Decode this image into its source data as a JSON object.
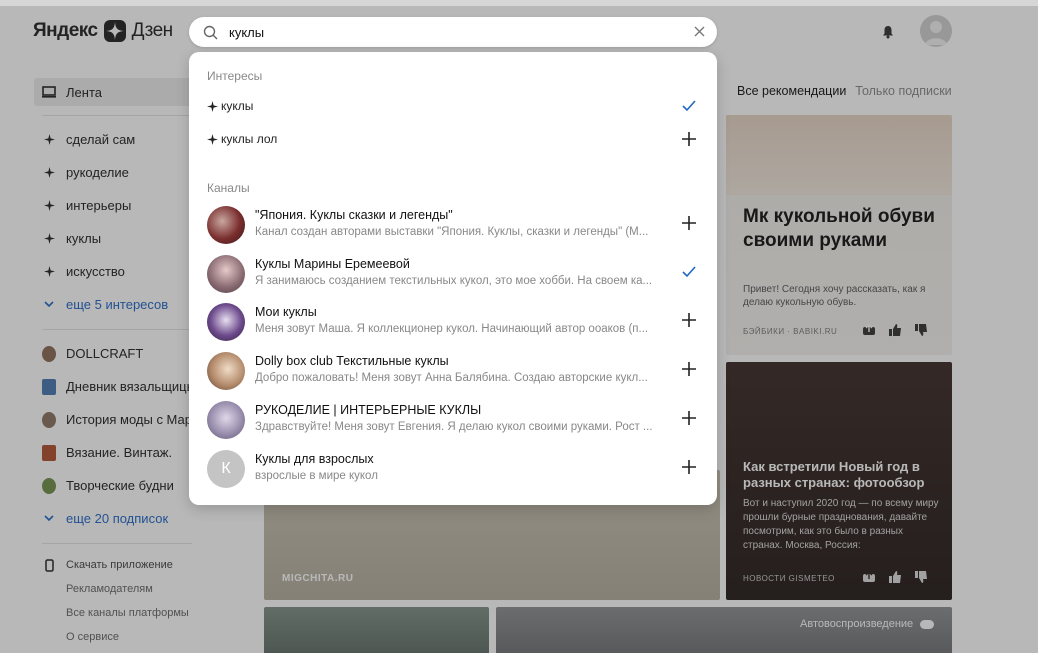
{
  "header": {
    "logo_left": "Яндекс",
    "logo_right": "Дзен"
  },
  "search": {
    "value": "куклы",
    "placeholder": ""
  },
  "dropdown": {
    "interests_title": "Интересы",
    "interests": [
      {
        "label": "куклы",
        "state": "added"
      },
      {
        "label": "куклы лол",
        "state": "add"
      }
    ],
    "channels_title": "Каналы",
    "channels": [
      {
        "name": "\"Япония. Куклы сказки и легенды\"",
        "desc": "Канал создан авторами выставки \"Япония. Куклы, сказки и легенды\" (М...",
        "state": "add",
        "avatar_color": "#7a2e2e"
      },
      {
        "name": "Куклы Марины Еремеевой",
        "desc": "Я занимаюсь созданием текстильных кукол, это мое хобби. На своем ка...",
        "state": "added",
        "avatar_color": "#8d6f76"
      },
      {
        "name": "Мои куклы",
        "desc": "Меня зовут Маша. Я коллекционер кукол. Начинающий автор ооаков (п...",
        "state": "add",
        "avatar_color": "#6d4a8c"
      },
      {
        "name": "Dolly box club Текстильные куклы",
        "desc": "Добро пожаловать! Меня зовут Анна Балябина. Создаю авторские кукл...",
        "state": "add",
        "avatar_color": "#b48b6b"
      },
      {
        "name": "РУКОДЕЛИЕ | ИНТЕРЬЕРНЫЕ КУКЛЫ",
        "desc": "Здравствуйте! Меня зовут Евгения. Я делаю кукол своими руками. Рост ...",
        "state": "add",
        "avatar_color": "#9a8fae"
      },
      {
        "name": "Куклы для взрослых",
        "desc": "взрослые в мире кукол",
        "state": "add",
        "avatar_color": "#c4c4c4",
        "avatar_letter": "К"
      }
    ]
  },
  "sidebar": {
    "feed": "Лента",
    "interests": [
      "сделай сам",
      "рукоделие",
      "интерьеры",
      "куклы",
      "искусство"
    ],
    "more_interests": "еще 5 интересов",
    "channels": [
      {
        "label": "DOLLCRAFT",
        "color": "#8a6a55"
      },
      {
        "label": "Дневник вязальщицы",
        "color": "#4a78b0"
      },
      {
        "label": "История моды с Марь",
        "color": "#8a7360"
      },
      {
        "label": "Вязание. Винтаж.",
        "color": "#b0502e"
      },
      {
        "label": "Творческие будни",
        "color": "#6f8f4a"
      }
    ],
    "more_subs": "еще 20 подписок",
    "download": "Скачать приложение",
    "links": [
      "Рекламодателям",
      "Все каналы платформы",
      "О сервисе"
    ]
  },
  "feed": {
    "tab_all": "Все рекомендации",
    "tab_subs": "Только подписки",
    "card1": {
      "title": "Мк кукольной обуви своими руками",
      "desc": "Привет! Сегодня хочу рассказать, как я делаю кукольную обувь.",
      "source": "БЭЙБИКИ · BABIKI.RU"
    },
    "card2": {
      "title": "Как встретили Новый год в разных странах: фотообзор",
      "desc": "Вот и наступил 2020 год — по всему миру прошли бурные празднования, давайте посмотрим, как это было в разных странах. Москва, Россия:",
      "source": "НОВОСТИ GISMETEO"
    },
    "card_left_source": "MIGCHITA.RU",
    "autoplay": "Автовоспроизведение"
  }
}
